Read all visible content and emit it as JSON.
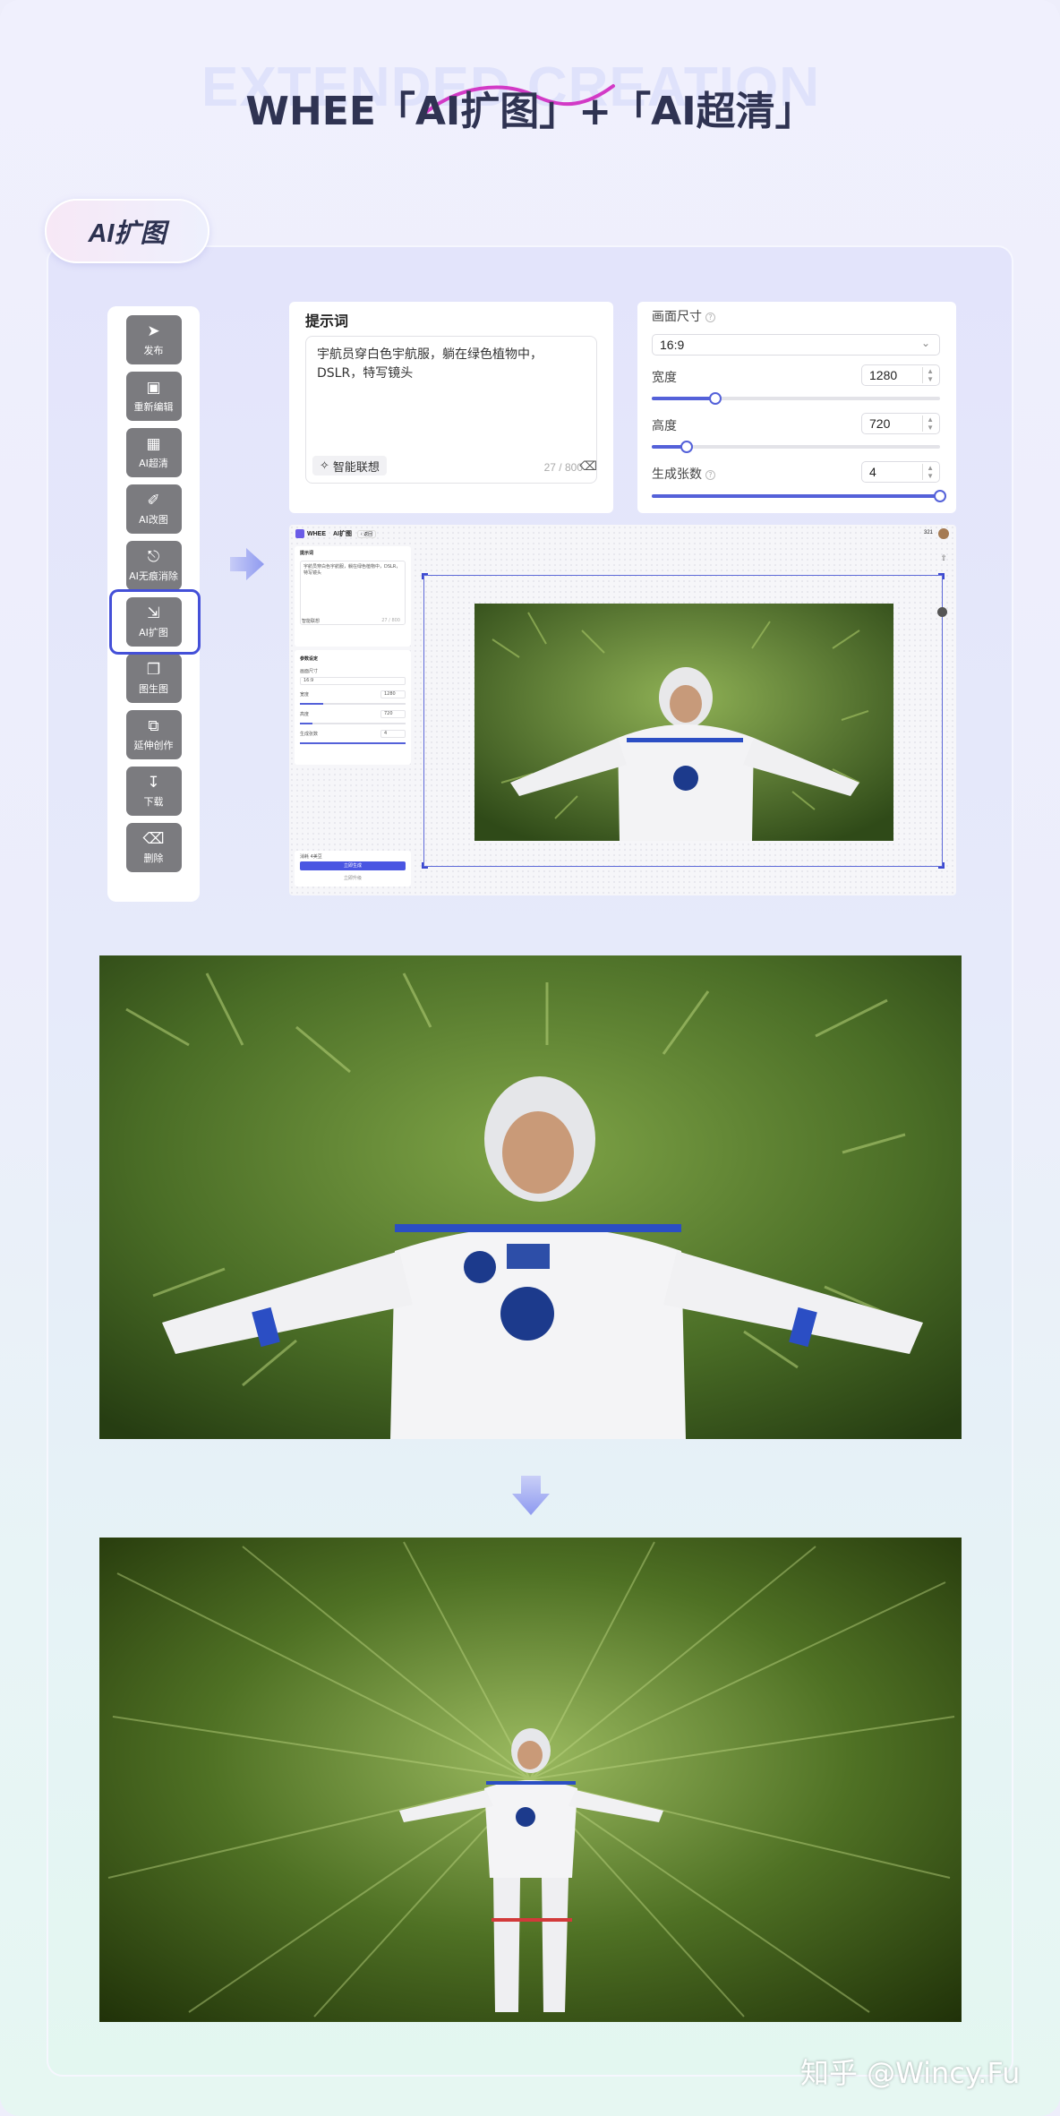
{
  "header": {
    "watermark_text": "EXTENDED CREATION",
    "headline": "WHEE「AI扩图」+「AI超清」"
  },
  "section": {
    "tag": "AI扩图"
  },
  "toolbar": {
    "items": [
      {
        "label": "发布",
        "icon": "send-icon"
      },
      {
        "label": "重新编辑",
        "icon": "image-edit-icon"
      },
      {
        "label": "AI超清",
        "icon": "hd-icon"
      },
      {
        "label": "AI改图",
        "icon": "brush-icon"
      },
      {
        "label": "AI无痕消除",
        "icon": "eraser-icon"
      },
      {
        "label": "AI扩图",
        "icon": "expand-icon"
      },
      {
        "label": "图生图",
        "icon": "images-icon"
      },
      {
        "label": "延伸创作",
        "icon": "copy-icon"
      },
      {
        "label": "下载",
        "icon": "download-icon"
      },
      {
        "label": "删除",
        "icon": "trash-icon"
      }
    ],
    "active": "AI扩图"
  },
  "prompt_panel": {
    "title": "提示词",
    "text": "宇航员穿白色宇航服，躺在绿色植物中，DSLR，特写镜头",
    "smart_button": "智能联想",
    "counter": "27 / 800"
  },
  "settings_panel": {
    "size_label": "画面尺寸",
    "size_value": "16:9",
    "width_label": "宽度",
    "width_value": "1280",
    "width_fraction": 0.22,
    "height_label": "高度",
    "height_value": "720",
    "height_fraction": 0.12,
    "count_label": "生成张数",
    "count_value": "4",
    "count_fraction": 1.0
  },
  "editor_preview": {
    "brand": "WHEE",
    "mode": "AI扩图",
    "back": "返回",
    "points": "321",
    "prompt_title": "提示词",
    "prompt_text": "宇航员穿白色宇航服，躺在绿色植物中，DSLR，特写镜头",
    "smart_button": "智能联想",
    "counter": "27 / 800",
    "params_title": "参数设定",
    "size_label": "画面尺寸",
    "size_value": "16:9",
    "width_label": "宽度",
    "width_value": "1280",
    "height_label": "高度",
    "height_value": "720",
    "count_label": "生成张数",
    "count_value": "4",
    "cost": "消耗 4美豆",
    "generate_button": "立即生成",
    "footer_link": "立即升级"
  },
  "colors": {
    "accent": "#4450d8",
    "headline": "#2f3352",
    "toolbar_button": "#7b7b7f"
  },
  "credit": "知乎 @Wincy.Fu"
}
